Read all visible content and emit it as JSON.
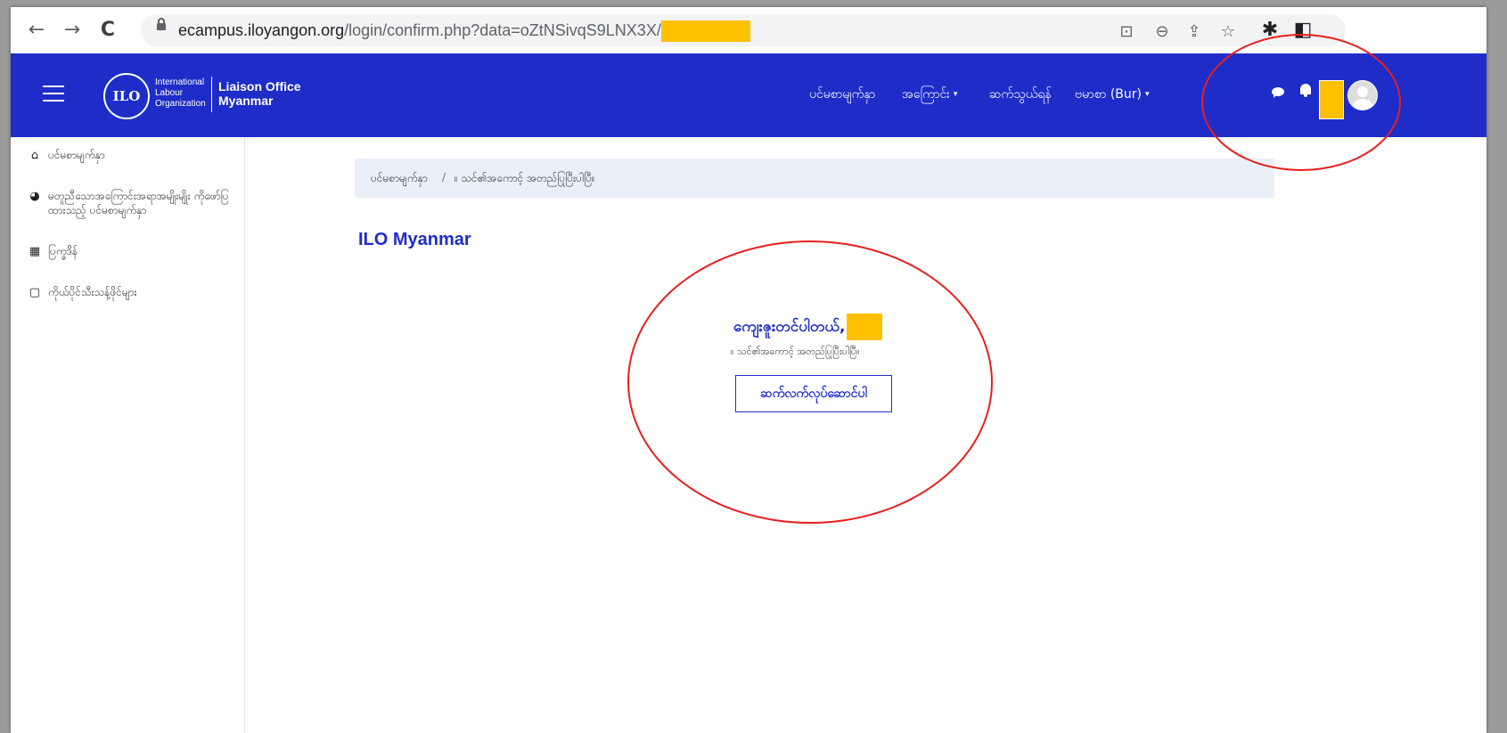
{
  "browser": {
    "url_host": "ecampus.iloyangon.org",
    "url_path": "/login/confirm.php?data=oZtNSivqS9LNX3X/",
    "back_glyph": "←",
    "forward_glyph": "→",
    "reload_glyph": "C",
    "translate_glyph": "⊡",
    "zoom_glyph": "⊖",
    "share_glyph": "⇪",
    "star_glyph": "☆",
    "extensions_glyph": "✱",
    "sidepanel_glyph": "◧"
  },
  "navbar": {
    "logo_text": "ILO",
    "org_line1": "International",
    "org_line2": "Labour",
    "org_line3": "Organization",
    "liaison_line1": "Liaison Office",
    "liaison_line2": "Myanmar",
    "menu": [
      {
        "label": "ပင်မစာမျက်နှာ"
      },
      {
        "label": "အကြောင်း"
      },
      {
        "label": "ဆက်သွယ်ရန်"
      },
      {
        "label": "ဗမာစာ (Bur)"
      }
    ],
    "caret": "▾",
    "accent_color": "#1e2dc8"
  },
  "sidebar": {
    "items": [
      {
        "icon": "home-icon",
        "glyph": "⌂",
        "label": "ပင်မစာမျက်နှာ"
      },
      {
        "icon": "dashboard-icon",
        "glyph": "◕",
        "label": "မတူညီသောအကြောင်းအရာအမျိုးမျိုး ကိုဖော်ပြထားသည့် ပင်မစာမျက်နှာ"
      },
      {
        "icon": "calendar-icon",
        "glyph": "▦",
        "label": "ပြက္ခဒိန်"
      },
      {
        "icon": "file-icon",
        "glyph": "▢",
        "label": "ကိုယ်ပိုင်သီးသန့်ဖိုင်များ"
      }
    ]
  },
  "main": {
    "breadcrumb_home": "ပင်မစာမျက်နှာ",
    "breadcrumb_sep": "/",
    "breadcrumb_current": "။ သင်၏အကောင့် အတည်ပြုပြီးပါပြီ။",
    "page_title": "ILO Myanmar",
    "thanks": "ကျေးဇူးတင်ပါတယ်,",
    "confirmed": "။ သင်၏အကောင့် အတည်ပြုပြီးပါပြီ။",
    "continue_label": "ဆက်လက်လုပ်ဆောင်ပါ"
  },
  "colors": {
    "redaction": "#ffc000",
    "annotation": "#e81e1e",
    "breadcrumb_bg": "#e9f0f8"
  }
}
